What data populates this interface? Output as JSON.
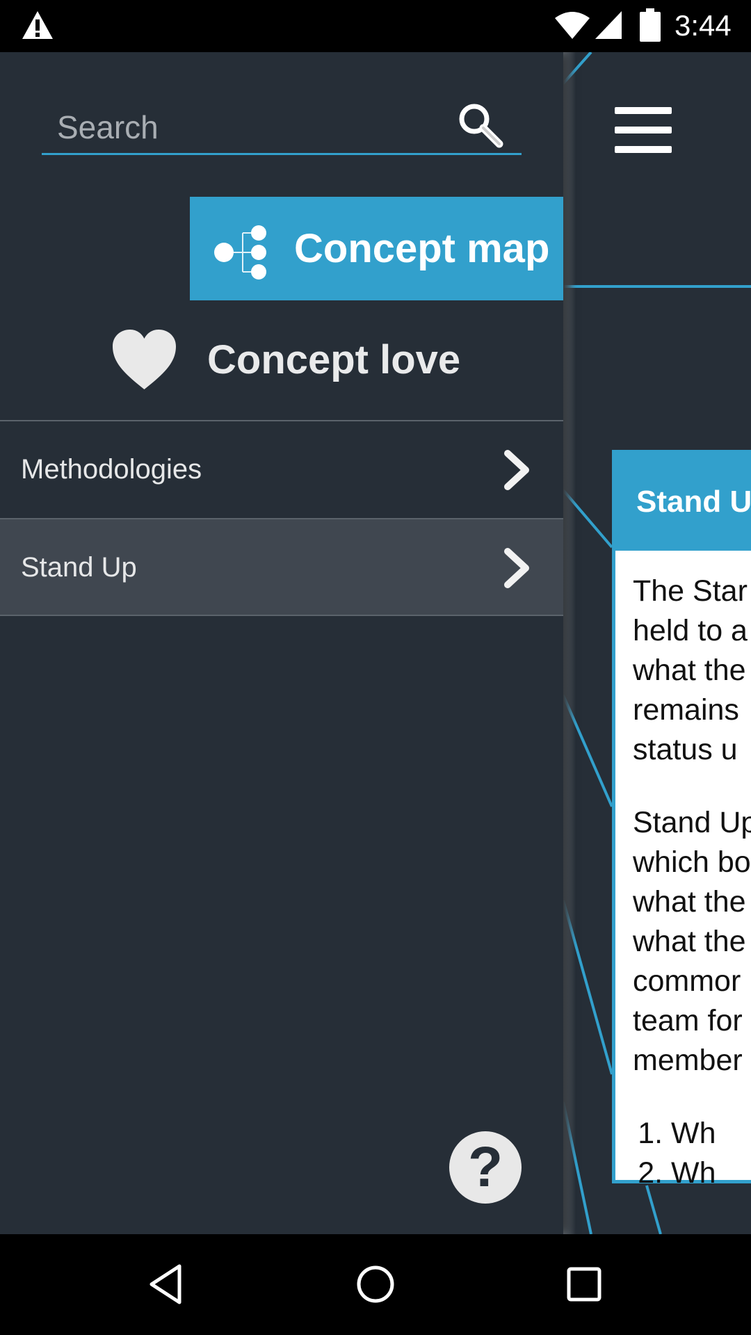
{
  "status_bar": {
    "time": "3:44",
    "icons": [
      "warning-icon",
      "wifi-icon",
      "signal-icon",
      "battery-icon"
    ]
  },
  "drawer": {
    "search": {
      "placeholder": "Search"
    },
    "concept_map_label": "Concept map",
    "concept_love_label": "Concept love",
    "nav_items": [
      {
        "label": "Methodologies"
      },
      {
        "label": "Stand Up"
      }
    ],
    "help_label": "?"
  },
  "card": {
    "title": "Stand U",
    "paragraph1": [
      "The Star",
      "held to a",
      "what the",
      "remains",
      "status u"
    ],
    "paragraph2": [
      "Stand Up",
      "which bo",
      "what the",
      "what the",
      "commor",
      "team for",
      "member"
    ],
    "list": [
      "Wh",
      "Wh"
    ]
  },
  "colors": {
    "accent": "#32a0cc",
    "drawer_bg": "#262e37",
    "active_item_bg": "#404750"
  }
}
